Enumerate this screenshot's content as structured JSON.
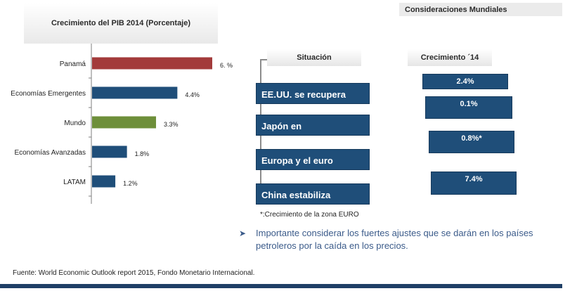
{
  "chart_title": "Crecimiento del PIB 2014 (Porcentaje)",
  "mundial_title": "Consideraciones Mundiales",
  "chart_data": {
    "type": "bar",
    "orientation": "horizontal",
    "title": "Crecimiento del PIB 2014 (Porcentaje)",
    "categories": [
      "Panamá",
      "Economías Emergentes",
      "Mundo",
      "Economías Avanzadas",
      "LATAM"
    ],
    "values": [
      6.2,
      4.4,
      3.3,
      1.8,
      1.2
    ],
    "data_labels": [
      "6. %",
      "4.4%",
      "3.3%",
      "1.8%",
      "1.2%"
    ],
    "colors": [
      "#a33b3b",
      "#1f4e79",
      "#6e8f3a",
      "#1f4e79",
      "#1f4e79"
    ],
    "xlim": [
      0,
      6.2
    ],
    "grid": false,
    "legend": "none"
  },
  "situacion": {
    "header": "Situación",
    "items": [
      "EE.UU. se recupera",
      "Japón en",
      "Europa y el euro",
      "China estabiliza"
    ]
  },
  "crecimiento": {
    "header": "Crecimiento ´14",
    "items": [
      "2.4%",
      "0.1%",
      "0.8%*",
      "7.4%"
    ]
  },
  "note": "*:Crecimiento de la zona  EURO",
  "bullet": "Importante considerar los fuertes ajustes que se darán en los países petroleros por la caída en los precios.",
  "source": "Fuente: World Economic Outlook report 2015, Fondo Monetario Internacional.",
  "colors": {
    "accent_blue": "#1f4e79",
    "bottom_bar": "#1f3f66"
  }
}
